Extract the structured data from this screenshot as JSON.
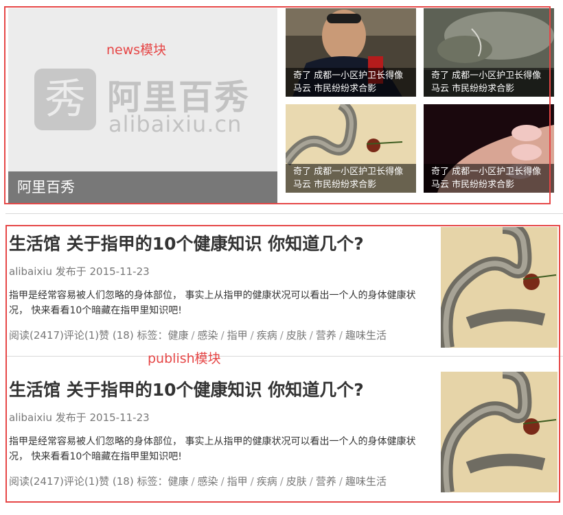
{
  "news": {
    "module_label": "news模块",
    "main": {
      "logo_glyph": "秀",
      "logo_cn": "阿里百秀",
      "logo_en": "alibaixiu.cn",
      "caption": "阿里百秀"
    },
    "thumbs": [
      {
        "line1": "奇了 成都一小区护卫长得像",
        "line2": "马云 市民纷纷求合影"
      },
      {
        "line1": "奇了 成都一小区护卫长得像",
        "line2": "马云 市民纷纷求合影"
      },
      {
        "line1": "奇了 成都一小区护卫长得像",
        "line2": "马云 市民纷纷求合影"
      },
      {
        "line1": "奇了 成都一小区护卫长得像",
        "line2": "马云 市民纷纷求合影"
      }
    ]
  },
  "publish": {
    "module_label": "publish模块",
    "posts": [
      {
        "title": "生活馆 关于指甲的10个健康知识 你知道几个?",
        "meta": "alibaixiu 发布于 2015-11-23",
        "summary": "指甲是经常容易被人们忽略的身体部位， 事实上从指甲的健康状况可以看出一个人的身体健康状况， 快来看看10个暗藏在指甲里知识吧!",
        "stats": "阅读(2417)评论(1)赞 (18) 标签：",
        "tags": [
          "健康",
          "感染",
          "指甲",
          "疾病",
          "皮肤",
          "营养",
          "趣味生活"
        ]
      },
      {
        "title": "生活馆 关于指甲的10个健康知识 你知道几个?",
        "meta": "alibaixiu 发布于 2015-11-23",
        "summary": "指甲是经常容易被人们忽略的身体部位， 事实上从指甲的健康状况可以看出一个人的身体健康状况， 快来看看10个暗藏在指甲里知识吧!",
        "stats": "阅读(2417)评论(1)赞 (18) 标签：",
        "tags": [
          "健康",
          "感染",
          "指甲",
          "疾病",
          "皮肤",
          "营养",
          "趣味生活"
        ]
      }
    ]
  },
  "colors": {
    "annotation_red": "#e64646",
    "caption_bg": "#646464"
  }
}
